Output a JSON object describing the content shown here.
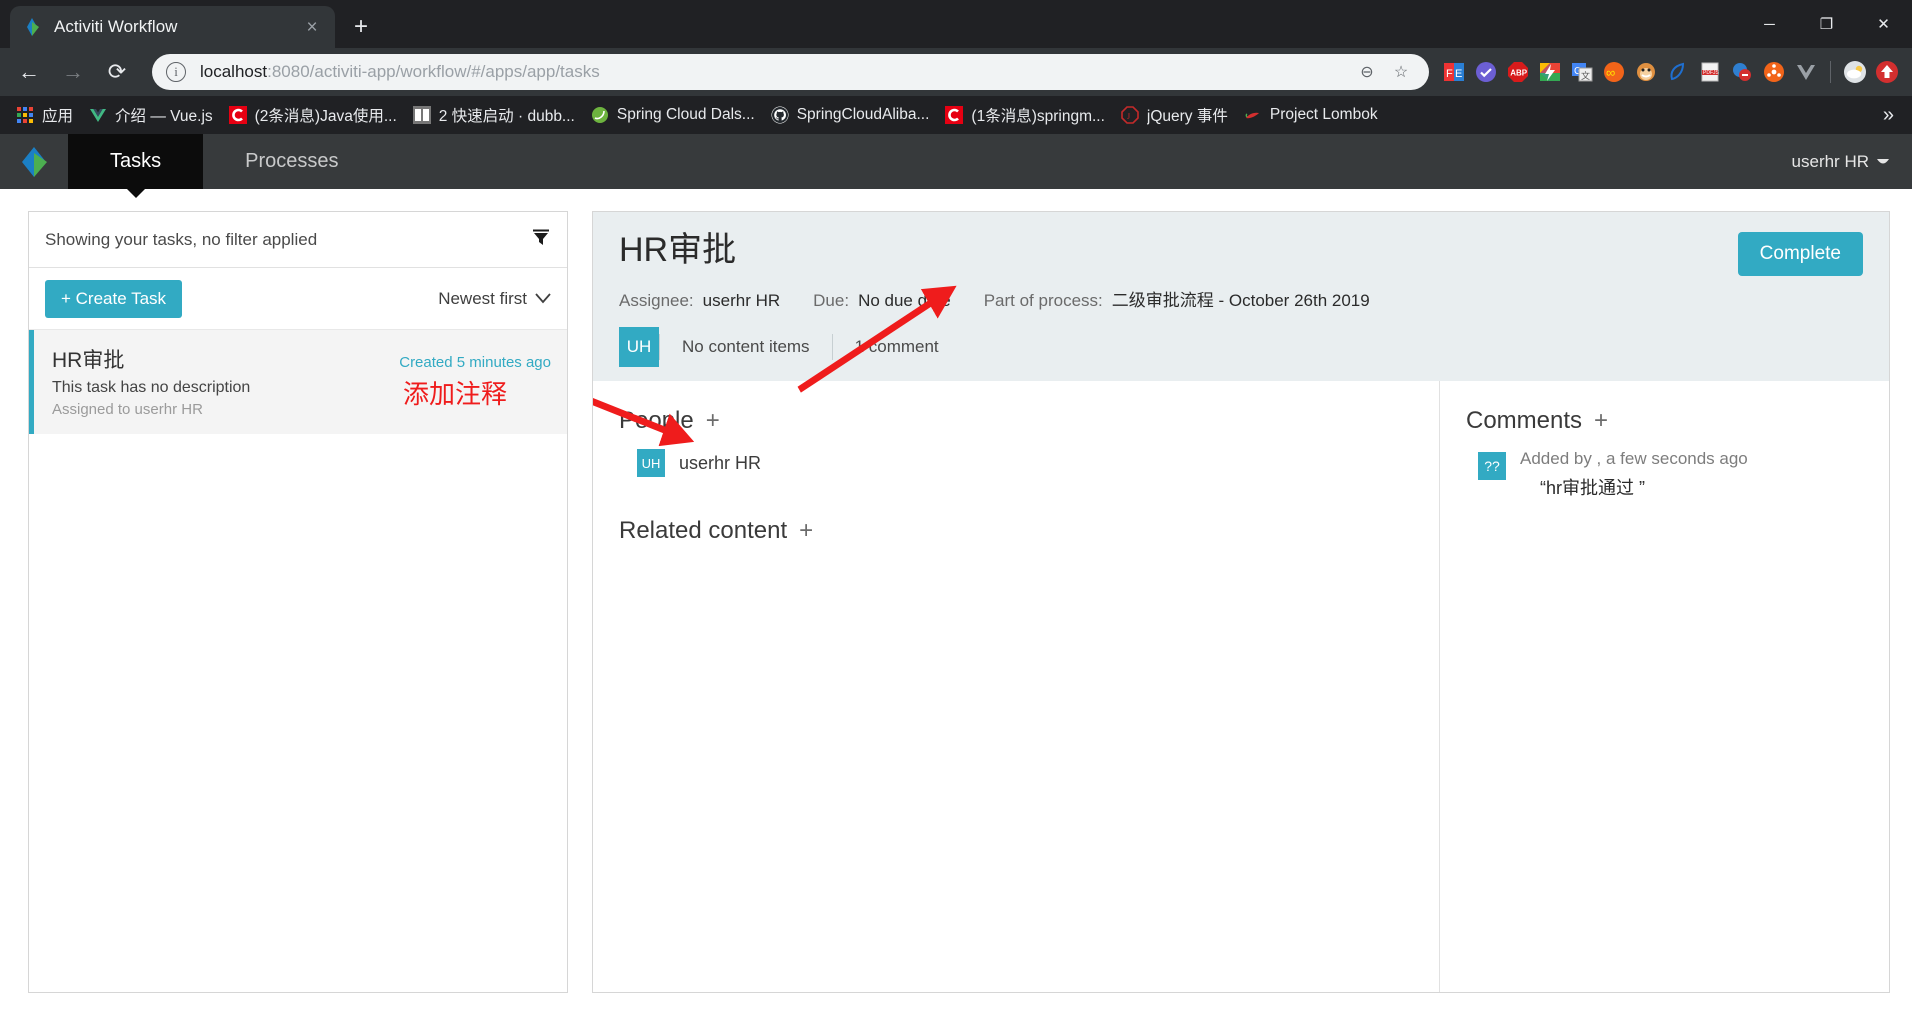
{
  "browser": {
    "tab": {
      "title": "Activiti Workflow",
      "favicon": "activiti-diamond-icon",
      "close_label": "×"
    },
    "new_tab_label": "+",
    "window_controls": {
      "minimize": "─",
      "maximize": "❐",
      "close": "✕"
    },
    "nav": {
      "back": "←",
      "forward": "→",
      "reload": "⟳"
    },
    "omnibox": {
      "info_glyph": "i",
      "url_host": "localhost",
      "url_path": ":8080/activiti-app/workflow/#/apps/app/tasks",
      "zoom_icon": "⊖",
      "bookmark_icon": "☆"
    },
    "extensions": [
      {
        "name": "fe-helper-icon",
        "label": "FE"
      },
      {
        "name": "check-circle-icon",
        "label": "✔"
      },
      {
        "name": "adblock-plus-icon",
        "label": "ABP"
      },
      {
        "name": "flash-icon",
        "label": "⚡"
      },
      {
        "name": "google-translate-icon",
        "label": "G"
      },
      {
        "name": "infinity-icon",
        "label": "∞"
      },
      {
        "name": "monkey-icon",
        "label": "🐵"
      },
      {
        "name": "leaf-pen-icon",
        "label": "✎"
      },
      {
        "name": "pdf-js-icon",
        "label": "PDF"
      },
      {
        "name": "block-icon",
        "label": "⛔"
      },
      {
        "name": "molecule-icon",
        "label": "⚛"
      },
      {
        "name": "vue-devtools-icon",
        "label": "V"
      },
      {
        "name": "weather-icon",
        "label": "⛅"
      },
      {
        "name": "upload-arrow-icon",
        "label": "⬆"
      }
    ],
    "bookmarks": [
      {
        "label": "应用",
        "icon": "apps-grid-icon"
      },
      {
        "label": "介绍 — Vue.js",
        "icon": "vue-icon"
      },
      {
        "label": "(2条消息)Java使用...",
        "icon": "csdn-icon"
      },
      {
        "label": "2 快速启动 · dubb...",
        "icon": "book-icon"
      },
      {
        "label": "Spring Cloud Dals...",
        "icon": "spring-icon"
      },
      {
        "label": "SpringCloudAliba...",
        "icon": "github-icon"
      },
      {
        "label": "(1条消息)springm...",
        "icon": "csdn-icon"
      },
      {
        "label": "jQuery 事件",
        "icon": "jquery-icon"
      },
      {
        "label": "Project Lombok",
        "icon": "lombok-icon"
      }
    ],
    "bookmarks_overflow": "»"
  },
  "app": {
    "logo_name": "activiti-logo",
    "tabs": [
      {
        "label": "Tasks",
        "active": true
      },
      {
        "label": "Processes",
        "active": false
      }
    ],
    "user": {
      "name": "userhr HR",
      "chevron": "❥"
    }
  },
  "task_list": {
    "filter_text": "Showing your tasks, no filter applied",
    "filter_icon": "funnel-icon",
    "create_label": "+ Create Task",
    "sort_label": "Newest first",
    "sort_chevron": "∨",
    "items": [
      {
        "name": "HR审批",
        "created": "Created 5 minutes ago",
        "description": "This task has no description",
        "assigned": "Assigned to userhr HR"
      }
    ]
  },
  "task_detail": {
    "title": "HR审批",
    "complete_label": "Complete",
    "meta": {
      "assignee_label": "Assignee:",
      "assignee_value": "userhr HR",
      "due_label": "Due:",
      "due_value": "No due date",
      "process_label": "Part of process:",
      "process_value": "二级审批流程 - October 26th 2019"
    },
    "avatar_initials": "UH",
    "subbar": [
      {
        "label": "No content items"
      },
      {
        "label": "1 comment"
      }
    ],
    "people": {
      "title": "People",
      "add_glyph": "+",
      "members": [
        {
          "initials": "UH",
          "name": "userhr HR"
        }
      ]
    },
    "related_content": {
      "title": "Related content",
      "add_glyph": "+"
    },
    "comments": {
      "title": "Comments",
      "add_glyph": "+",
      "items": [
        {
          "avatar_initials": "??",
          "meta": "Added by , a few seconds ago",
          "text": "“hr审批通过 ”"
        }
      ]
    }
  },
  "annotations": {
    "color": "#ef1c1c",
    "note_text": "添加注释"
  },
  "colors": {
    "accent": "#32aac3",
    "chrome_dark": "#202124",
    "chrome_toolbar": "#323639",
    "appnav": "#373a3c",
    "detail_head": "#e9eef0",
    "annotation_red": "#ef1c1c"
  }
}
